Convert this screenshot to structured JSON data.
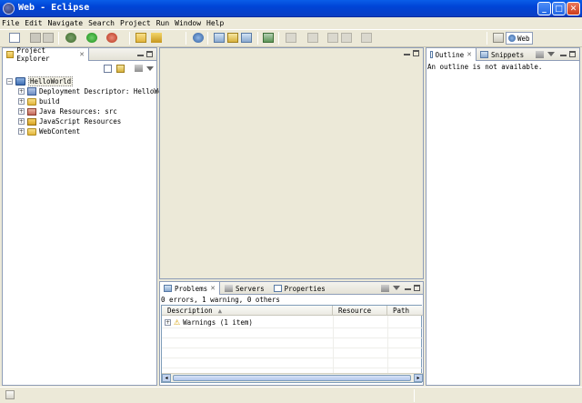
{
  "window": {
    "title": "Web - Eclipse",
    "minimize_glyph": "_",
    "maximize_glyph": "□",
    "close_glyph": "✕"
  },
  "menu": [
    "File",
    "Edit",
    "Navigate",
    "Search",
    "Project",
    "Run",
    "Window",
    "Help"
  ],
  "perspective": {
    "label": "Web"
  },
  "project_explorer": {
    "title": "Project Explorer",
    "tree": [
      {
        "label": "HelloWorld",
        "expanded": true,
        "icon": "project-icon"
      },
      {
        "label": "Deployment Descriptor: HelloWorld",
        "icon": "deployment-descriptor-icon"
      },
      {
        "label": "build",
        "icon": "folder-icon"
      },
      {
        "label": "Java Resources: src",
        "icon": "java-resources-icon"
      },
      {
        "label": "JavaScript Resources",
        "icon": "javascript-resources-icon"
      },
      {
        "label": "WebContent",
        "icon": "folder-icon"
      }
    ]
  },
  "outline": {
    "title": "Outline",
    "message": "An outline is not available."
  },
  "snippets": {
    "title": "Snippets"
  },
  "bottom_panel": {
    "tabs": [
      "Problems",
      "Servers",
      "Properties"
    ],
    "summary": "0 errors, 1 warning, 0 others",
    "columns": [
      "Description",
      "Resource",
      "Path"
    ],
    "rows": [
      {
        "description": "Warnings (1 item)",
        "resource": "",
        "path": ""
      }
    ]
  },
  "colors": {
    "titlebar": "#0054e3",
    "chrome": "#ece9d8",
    "panel_border": "#8e9db8"
  }
}
